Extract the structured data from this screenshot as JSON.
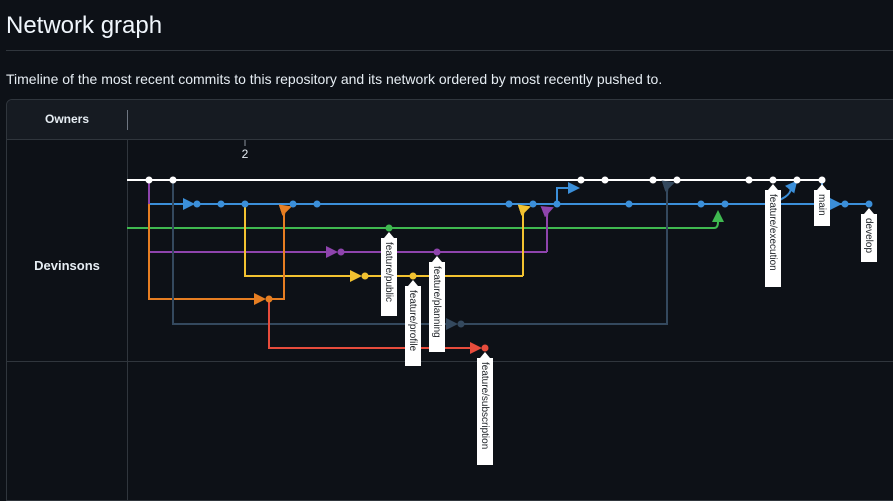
{
  "page": {
    "title": "Network graph",
    "description": "Timeline of the most recent commits to this repository and its network ordered by most recently pushed to."
  },
  "table": {
    "owners_header": "Owners",
    "owners": [
      "Devinsons"
    ]
  },
  "graph": {
    "date_label": "2",
    "branch_labels": {
      "feature_public": "feature/public",
      "feature_profile": "feature/profile",
      "feature_planning": "feature/planning",
      "feature_subscription": "feature/subscription",
      "feature_execution": "feature/execution",
      "main": "main",
      "develop": "develop"
    },
    "colors": {
      "main": "#ffffff",
      "develop": "#3b8fd9",
      "green": "#3fb950",
      "purple": "#8e44ad",
      "yellow": "#f2c230",
      "orange": "#e67e22",
      "slate": "#34495e",
      "red": "#e74c3c"
    }
  }
}
